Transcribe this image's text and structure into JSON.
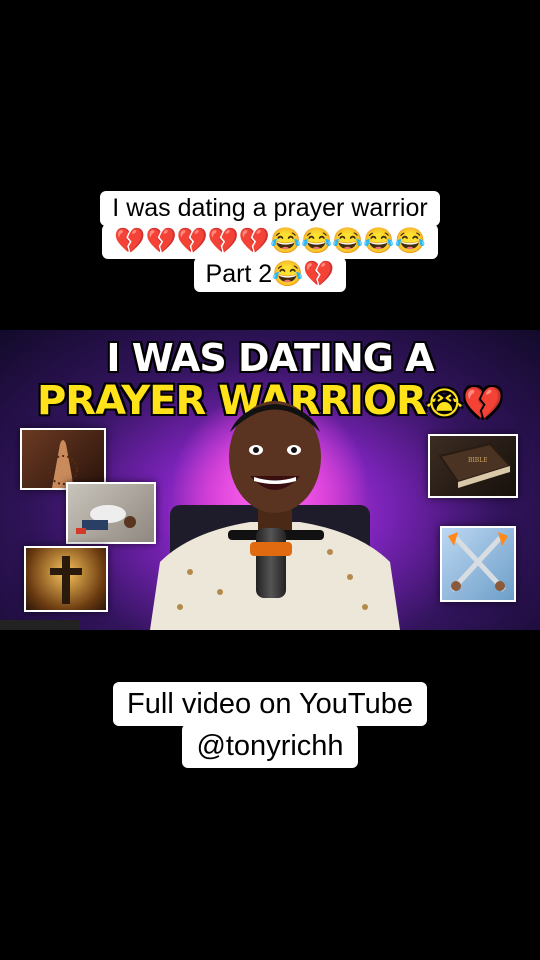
{
  "caption_top": {
    "line1": "I was dating a prayer warrior",
    "line2": "💔💔💔💔💔😂😂😂😂😂",
    "line3": "Part 2😂💔"
  },
  "thumbnail": {
    "title_line1": "I WAS DATING A",
    "title_line2": "PRAYER WARRIOR",
    "title_emojis": "😭💔",
    "colors": {
      "title1": "#ffffff",
      "title2": "#ffe21a",
      "background": "#7a23b8"
    },
    "images": [
      "praying-hands",
      "kneeling-prayer",
      "glowing-cross",
      "holy-bible",
      "crossed-flaming-swords"
    ]
  },
  "caption_bottom": {
    "line1": "Full video on YouTube",
    "line2": "@tonyrichh"
  }
}
